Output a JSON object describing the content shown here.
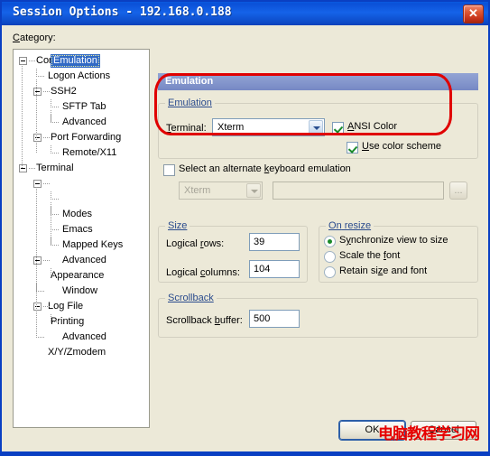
{
  "window": {
    "title": "Session Options - 192.168.0.188",
    "close_icon": "close-icon",
    "close_glyph": "✕",
    "accent_title_bg": "#0a50d8",
    "client_bg": "#ece9d8"
  },
  "sidebar": {
    "label": "Category:",
    "selected": "Emulation",
    "items": [
      {
        "label": "Connection",
        "level": 0,
        "expander": true
      },
      {
        "label": "Logon Actions",
        "level": 1,
        "expander": false
      },
      {
        "label": "SSH2",
        "level": 1,
        "expander": true
      },
      {
        "label": "SFTP Tab",
        "level": 2,
        "expander": false
      },
      {
        "label": "Advanced",
        "level": 2,
        "expander": false
      },
      {
        "label": "Port Forwarding",
        "level": 1,
        "expander": true
      },
      {
        "label": "Remote/X11",
        "level": 2,
        "expander": false
      },
      {
        "label": "Terminal",
        "level": 0,
        "expander": true
      },
      {
        "label": "Emulation",
        "level": 1,
        "expander": true,
        "selected": true
      },
      {
        "label": "Modes",
        "level": 2,
        "expander": false
      },
      {
        "label": "Emacs",
        "level": 2,
        "expander": false
      },
      {
        "label": "Mapped Keys",
        "level": 2,
        "expander": false
      },
      {
        "label": "Advanced",
        "level": 2,
        "expander": false
      },
      {
        "label": "Appearance",
        "level": 1,
        "expander": true
      },
      {
        "label": "Window",
        "level": 2,
        "expander": false
      },
      {
        "label": "Log File",
        "level": 1,
        "expander": false
      },
      {
        "label": "Printing",
        "level": 1,
        "expander": true
      },
      {
        "label": "Advanced",
        "level": 2,
        "expander": false
      },
      {
        "label": "X/Y/Zmodem",
        "level": 1,
        "expander": false
      }
    ]
  },
  "pane": {
    "header": "Emulation",
    "emulation_group": {
      "caption": "Emulation",
      "terminal_label": "Terminal:",
      "terminal_value": "Xterm",
      "ansi_color": {
        "label": "ANSI Color",
        "checked": true
      },
      "use_color_scheme": {
        "label": "Use color scheme",
        "checked": true
      }
    },
    "alt_keyboard": {
      "label": "Select an alternate keyboard emulation",
      "checked": false,
      "combo_value": "Xterm",
      "path_value": "",
      "browse_label": "..."
    },
    "size_group": {
      "caption": "Size",
      "rows_label": "Logical rows:",
      "rows_value": "39",
      "cols_label": "Logical columns:",
      "cols_value": "104"
    },
    "resize_group": {
      "caption": "On resize",
      "options": [
        {
          "label": "Synchronize view to size",
          "selected": true
        },
        {
          "label": "Scale the font",
          "selected": false
        },
        {
          "label": "Retain size and font",
          "selected": false
        }
      ]
    },
    "scrollback_group": {
      "caption": "Scrollback",
      "buffer_label": "Scrollback buffer:",
      "buffer_value": "500"
    }
  },
  "footer": {
    "ok_label": "OK",
    "cancel_label": "Cancel"
  },
  "annotation": {
    "color": "#e00000",
    "watermark": "电脑教程学习网"
  }
}
